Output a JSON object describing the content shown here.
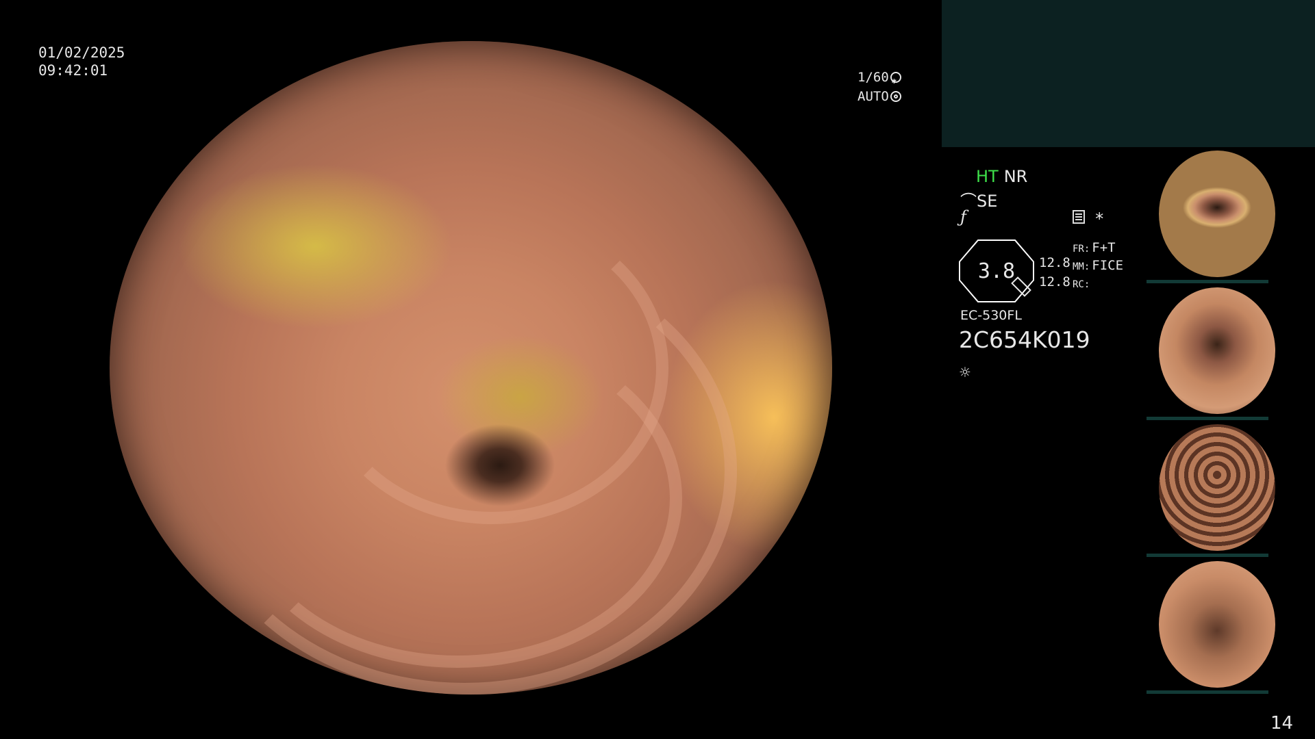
{
  "datetime": {
    "date": "01/02/2025",
    "time": "09:42:01"
  },
  "exposure": {
    "shutter": "1/60",
    "mode": "AUTO"
  },
  "modes": {
    "ht": "HT",
    "nr": "NR",
    "se": "SE"
  },
  "gauge": {
    "value": "3.8"
  },
  "vals": {
    "v1": "12.8",
    "v2": "12.8"
  },
  "labels": {
    "fr_key": "FR:",
    "fr_val": "F+T",
    "mm_key": "MM:",
    "mm_val": "FICE",
    "rc_key": "RC:"
  },
  "scope": {
    "model": "EC-530FL",
    "serial": "2C654K019"
  },
  "icons": [
    "scope-icon",
    "f-icon",
    "document-icon",
    "star-icon",
    "light-icon",
    "gear-icon",
    "shutter-icon"
  ],
  "page": {
    "number": "14"
  },
  "colors": {
    "ht": "#3ee04a",
    "panel": "#0c2121",
    "text": "#e8e8e8"
  }
}
